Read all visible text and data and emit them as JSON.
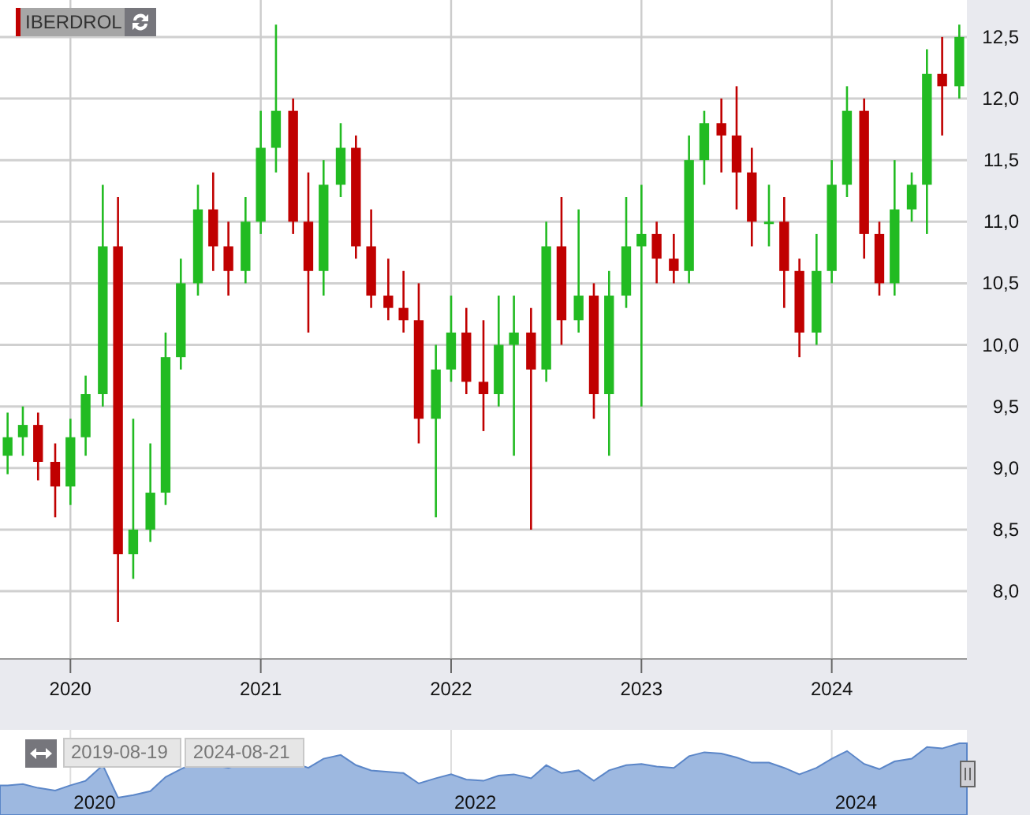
{
  "legend": {
    "symbol": "IBERDROL",
    "color": "#c00000"
  },
  "chart": {
    "chart_data": {
      "type": "candlestick",
      "grid": true,
      "x": [
        2019.67,
        2019.75,
        2019.83,
        2019.92,
        2020.0,
        2020.08,
        2020.17,
        2020.25,
        2020.33,
        2020.42,
        2020.5,
        2020.58,
        2020.67,
        2020.75,
        2020.83,
        2020.92,
        2021.0,
        2021.08,
        2021.17,
        2021.25,
        2021.33,
        2021.42,
        2021.5,
        2021.58,
        2021.67,
        2021.75,
        2021.83,
        2021.92,
        2022.0,
        2022.08,
        2022.17,
        2022.25,
        2022.33,
        2022.42,
        2022.5,
        2022.58,
        2022.67,
        2022.75,
        2022.83,
        2022.92,
        2023.0,
        2023.08,
        2023.17,
        2023.25,
        2023.33,
        2023.42,
        2023.5,
        2023.58,
        2023.67,
        2023.75,
        2023.83,
        2023.92,
        2024.0,
        2024.08,
        2024.17,
        2024.25,
        2024.33,
        2024.42,
        2024.5,
        2024.58,
        2024.67
      ],
      "ohlc": [
        [
          9.1,
          9.45,
          8.95,
          9.25
        ],
        [
          9.25,
          9.5,
          9.1,
          9.35
        ],
        [
          9.35,
          9.45,
          8.9,
          9.05
        ],
        [
          9.05,
          9.2,
          8.6,
          8.85
        ],
        [
          8.85,
          9.4,
          8.7,
          9.25
        ],
        [
          9.25,
          9.75,
          9.1,
          9.6
        ],
        [
          9.6,
          11.3,
          9.5,
          10.8
        ],
        [
          10.8,
          11.2,
          7.75,
          8.3
        ],
        [
          8.3,
          9.4,
          8.1,
          8.5
        ],
        [
          8.5,
          9.2,
          8.4,
          8.8
        ],
        [
          8.8,
          10.1,
          8.7,
          9.9
        ],
        [
          9.9,
          10.7,
          9.8,
          10.5
        ],
        [
          10.5,
          11.3,
          10.4,
          11.1
        ],
        [
          11.1,
          11.4,
          10.6,
          10.8
        ],
        [
          10.8,
          11.0,
          10.4,
          10.6
        ],
        [
          10.6,
          11.2,
          10.5,
          11.0
        ],
        [
          11.0,
          11.9,
          10.9,
          11.6
        ],
        [
          11.6,
          12.6,
          11.4,
          11.9
        ],
        [
          11.9,
          12.0,
          10.9,
          11.0
        ],
        [
          11.0,
          11.4,
          10.1,
          10.6
        ],
        [
          10.6,
          11.5,
          10.4,
          11.3
        ],
        [
          11.3,
          11.8,
          11.2,
          11.6
        ],
        [
          11.6,
          11.7,
          10.7,
          10.8
        ],
        [
          10.8,
          11.1,
          10.3,
          10.4
        ],
        [
          10.4,
          10.7,
          10.2,
          10.3
        ],
        [
          10.3,
          10.6,
          10.1,
          10.2
        ],
        [
          10.2,
          10.5,
          9.2,
          9.4
        ],
        [
          9.4,
          10.0,
          8.6,
          9.8
        ],
        [
          9.8,
          10.4,
          9.7,
          10.1
        ],
        [
          10.1,
          10.3,
          9.6,
          9.7
        ],
        [
          9.7,
          10.2,
          9.3,
          9.6
        ],
        [
          9.6,
          10.4,
          9.5,
          10.0
        ],
        [
          10.0,
          10.4,
          9.1,
          10.1
        ],
        [
          10.1,
          10.3,
          8.5,
          9.8
        ],
        [
          9.8,
          11.0,
          9.7,
          10.8
        ],
        [
          10.8,
          11.2,
          10.0,
          10.2
        ],
        [
          10.2,
          11.1,
          10.1,
          10.4
        ],
        [
          10.4,
          10.5,
          9.4,
          9.6
        ],
        [
          9.6,
          10.6,
          9.1,
          10.4
        ],
        [
          10.4,
          11.2,
          10.3,
          10.8
        ],
        [
          10.8,
          11.3,
          9.5,
          10.9
        ],
        [
          10.9,
          11.0,
          10.5,
          10.7
        ],
        [
          10.7,
          10.9,
          10.5,
          10.6
        ],
        [
          10.6,
          11.7,
          10.5,
          11.5
        ],
        [
          11.5,
          11.9,
          11.3,
          11.8
        ],
        [
          11.8,
          12.0,
          11.4,
          11.7
        ],
        [
          11.7,
          12.1,
          11.1,
          11.4
        ],
        [
          11.4,
          11.6,
          10.8,
          11.0
        ],
        [
          11.0,
          11.3,
          10.8,
          11.0
        ],
        [
          11.0,
          11.2,
          10.3,
          10.6
        ],
        [
          10.6,
          10.7,
          9.9,
          10.1
        ],
        [
          10.1,
          10.9,
          10.0,
          10.6
        ],
        [
          10.6,
          11.5,
          10.5,
          11.3
        ],
        [
          11.3,
          12.1,
          11.2,
          11.9
        ],
        [
          11.9,
          12.0,
          10.7,
          10.9
        ],
        [
          10.9,
          11.0,
          10.4,
          10.5
        ],
        [
          10.5,
          11.5,
          10.4,
          11.1
        ],
        [
          11.1,
          11.4,
          11.0,
          11.3
        ],
        [
          11.3,
          12.4,
          10.9,
          12.2
        ],
        [
          12.2,
          12.5,
          11.7,
          12.1
        ],
        [
          12.1,
          12.6,
          12.0,
          12.5
        ]
      ],
      "xlim": [
        2019.63,
        2024.71
      ],
      "ylim": [
        7.45,
        12.8
      ],
      "xticks": [
        {
          "value": 2020,
          "label": "2020"
        },
        {
          "value": 2021,
          "label": "2021"
        },
        {
          "value": 2022,
          "label": "2022"
        },
        {
          "value": 2023,
          "label": "2023"
        },
        {
          "value": 2024,
          "label": "2024"
        }
      ],
      "yticks": [
        {
          "value": 8,
          "label": "8,0"
        },
        {
          "value": 8.5,
          "label": "8,5"
        },
        {
          "value": 9,
          "label": "9,0"
        },
        {
          "value": 9.5,
          "label": "9,5"
        },
        {
          "value": 10,
          "label": "10,0"
        },
        {
          "value": 10.5,
          "label": "10,5"
        },
        {
          "value": 11,
          "label": "11,0"
        },
        {
          "value": 11.5,
          "label": "11,5"
        },
        {
          "value": 12,
          "label": "12,0"
        },
        {
          "value": 12.5,
          "label": "12,5"
        }
      ]
    }
  },
  "navigator": {
    "from": "2019-08-19",
    "to": "2024-08-21",
    "labels": [
      "2020",
      "2022",
      "2024"
    ]
  }
}
